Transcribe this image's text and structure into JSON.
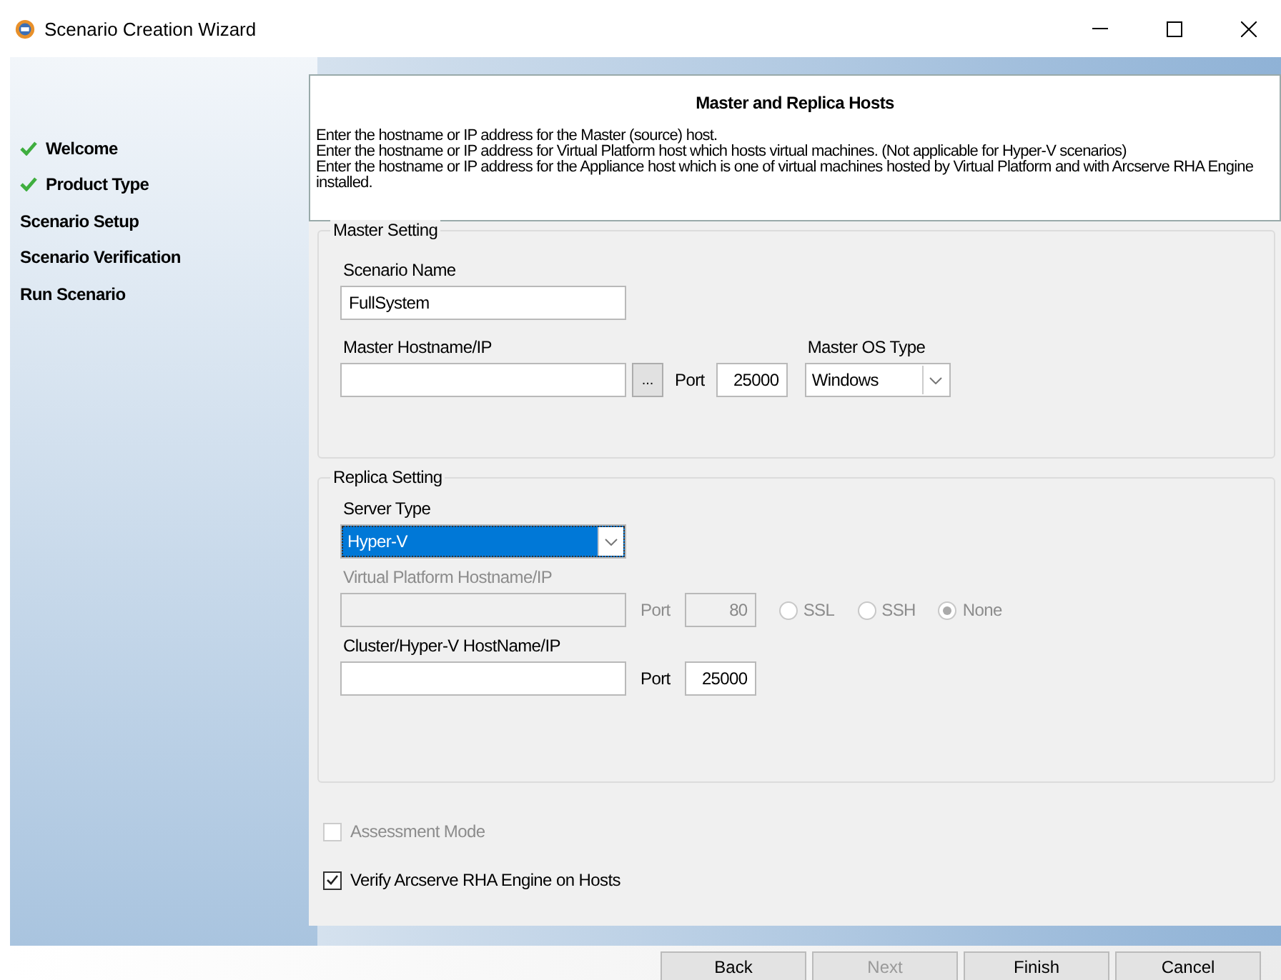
{
  "window": {
    "title": "Scenario Creation Wizard"
  },
  "steps": [
    {
      "label": "Welcome",
      "done": true
    },
    {
      "label": "Product Type",
      "done": true
    },
    {
      "label": "Scenario Setup",
      "done": false
    },
    {
      "label": "Scenario Verification",
      "done": false
    },
    {
      "label": "Run Scenario",
      "done": false
    }
  ],
  "header": {
    "title": "Master and Replica Hosts",
    "lines": [
      "Enter the hostname or IP address for the Master (source) host.",
      "Enter the hostname or IP address for Virtual Platform host which hosts virtual machines. (Not applicable for Hyper-V scenarios)",
      "Enter the hostname or IP address for the Appliance host which is one of virtual machines hosted by Virtual Platform and with Arcserve RHA Engine installed."
    ]
  },
  "master_setting": {
    "title": "Master Setting",
    "scenario_name_label": "Scenario Name",
    "scenario_name_value": "FullSystem",
    "hostname_label": "Master Hostname/IP",
    "browse_button": "...",
    "port_label": "Port",
    "port_value": "25000",
    "os_label": "Master OS Type",
    "os_value": "Windows"
  },
  "replica_setting": {
    "title": "Replica Setting",
    "server_type_label": "Server Type",
    "server_type_value": "Hyper-V",
    "server_type_focused": true,
    "vp_label": "Virtual Platform Hostname/IP",
    "vp_disabled": true,
    "vp_port_label": "Port",
    "vp_port_value": "80",
    "protocols": [
      {
        "label": "SSL",
        "selected": false
      },
      {
        "label": "SSH",
        "selected": false
      },
      {
        "label": "None",
        "selected": true
      }
    ],
    "cluster_label": "Cluster/Hyper-V HostName/IP",
    "cluster_port_label": "Port",
    "cluster_port_value": "25000"
  },
  "options": [
    {
      "label": "Assessment Mode",
      "checked": false,
      "disabled": true
    },
    {
      "label": "Verify Arcserve RHA Engine on Hosts",
      "checked": true,
      "disabled": false
    }
  ],
  "buttons": [
    {
      "label": "Back",
      "disabled": false
    },
    {
      "label": "Next",
      "disabled": true
    },
    {
      "label": "Finish",
      "disabled": false
    },
    {
      "label": "Cancel",
      "disabled": false
    }
  ]
}
